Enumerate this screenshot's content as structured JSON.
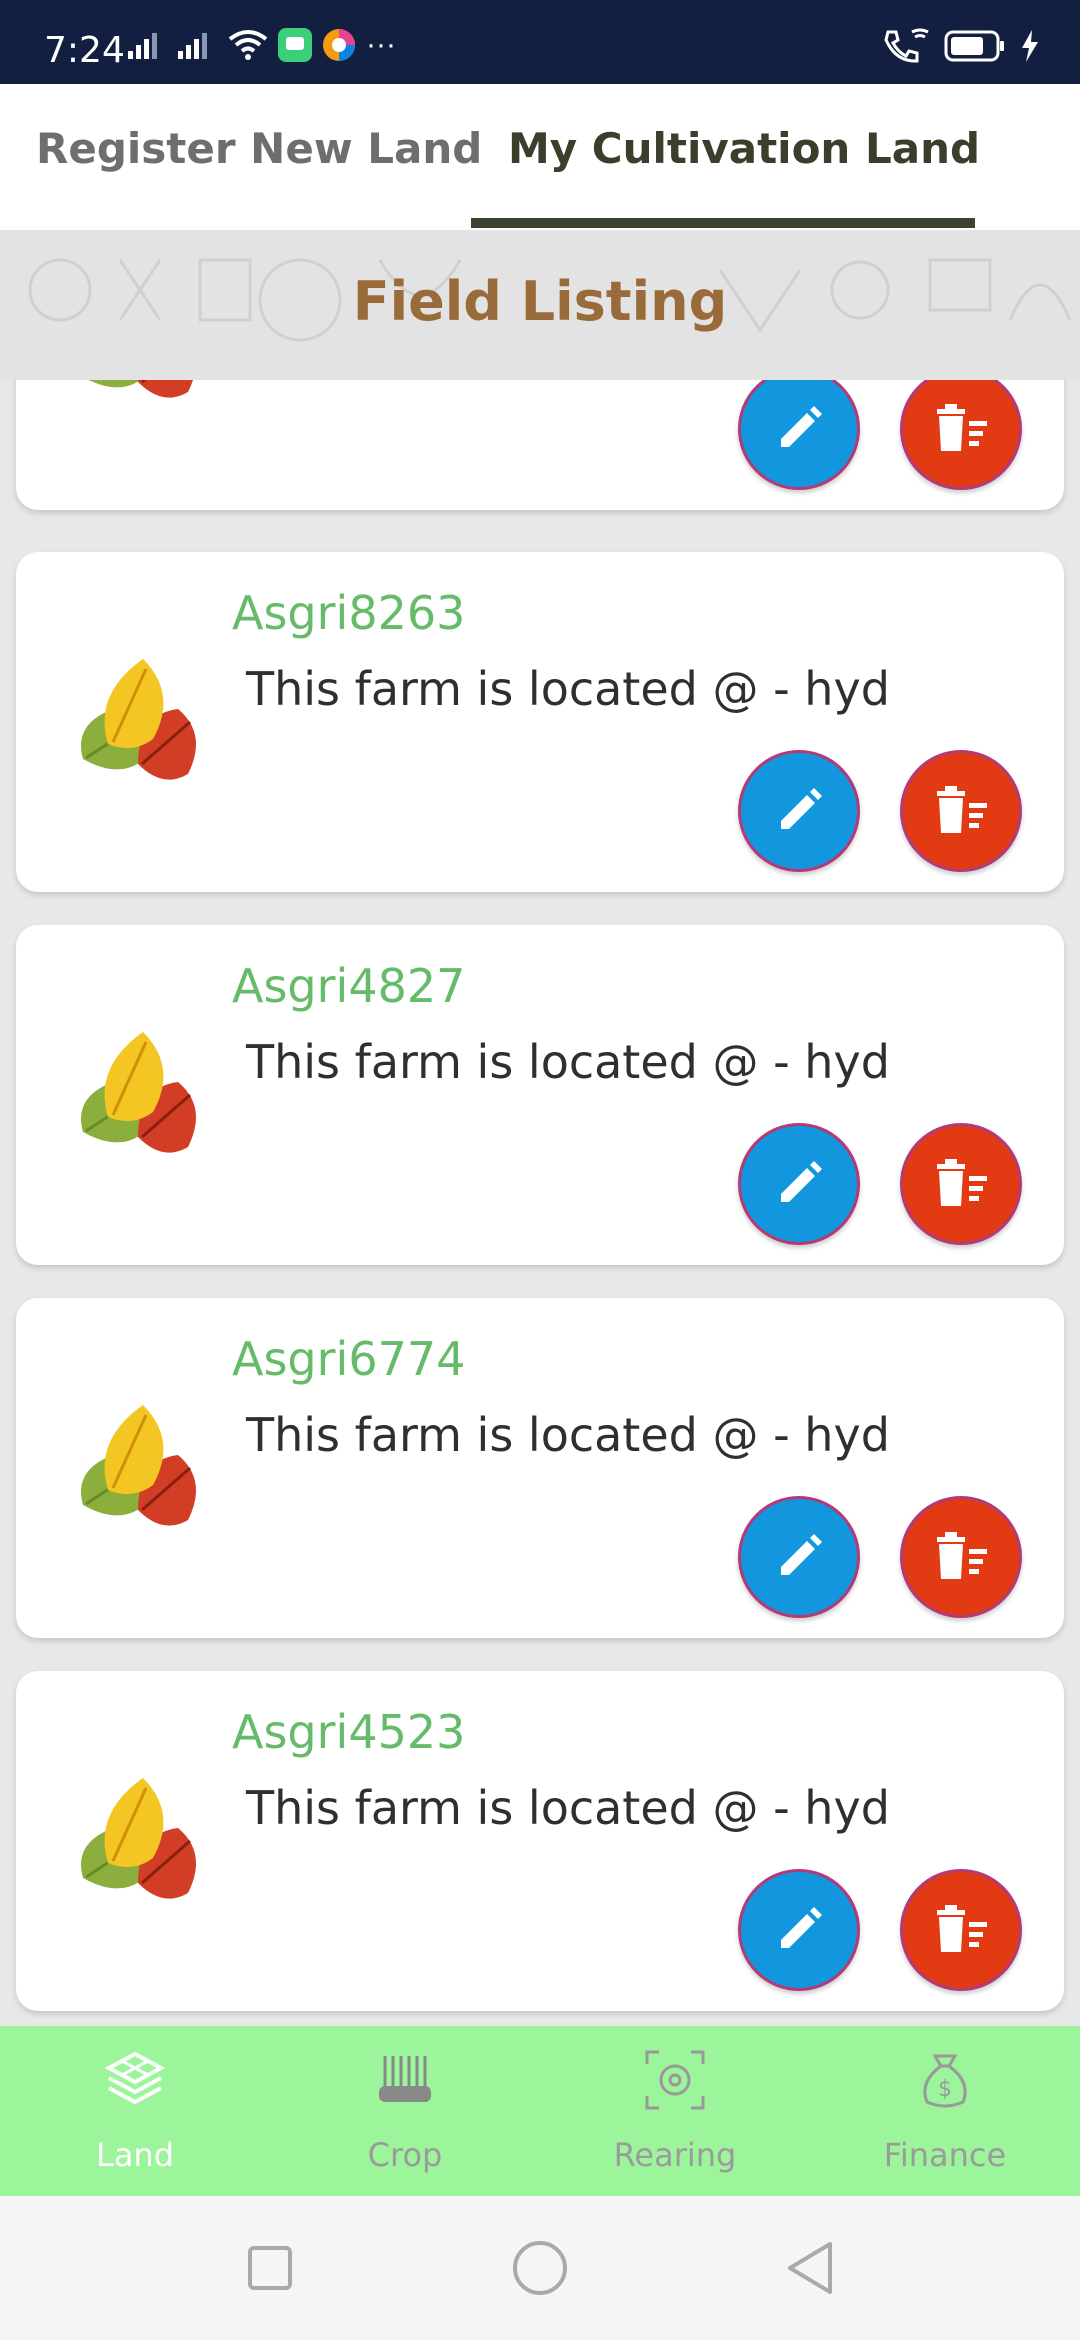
{
  "status_bar": {
    "time": "7:24",
    "overflow": "···",
    "icons": [
      "signal-icon",
      "signal-icon",
      "wifi-icon",
      "chat-app-icon",
      "browser-app-icon",
      "wifi-calling-icon",
      "battery-icon",
      "charging-icon"
    ]
  },
  "tabs": [
    {
      "label": "Register New Land",
      "active": false
    },
    {
      "label": "My Cultivation Land",
      "active": true
    }
  ],
  "heading": {
    "title": "Field Listing"
  },
  "farms": [
    {
      "name": "",
      "location": ""
    },
    {
      "name": "Asgri8263",
      "location": "This farm is located @ - hyd"
    },
    {
      "name": "Asgri4827",
      "location": "This farm is located @ - hyd"
    },
    {
      "name": "Asgri6774",
      "location": "This farm is located @ - hyd"
    },
    {
      "name": "Asgri4523",
      "location": "This farm is located @ - hyd"
    }
  ],
  "bottom_nav": {
    "items": [
      {
        "label": "Land",
        "icon": "layers-icon",
        "active": true
      },
      {
        "label": "Crop",
        "icon": "crop-icon",
        "active": false
      },
      {
        "label": "Rearing",
        "icon": "scan-icon",
        "active": false
      },
      {
        "label": "Finance",
        "icon": "money-bag-icon",
        "active": false
      }
    ]
  },
  "colors": {
    "status_bar": "#121f40",
    "tab_active": "#3a3f2c",
    "heading": "#9a6b3a",
    "farm_name": "#66bb6a",
    "edit_button": "#1296de",
    "delete_button": "#e23a12",
    "bottom_nav": "#9cf59a"
  }
}
